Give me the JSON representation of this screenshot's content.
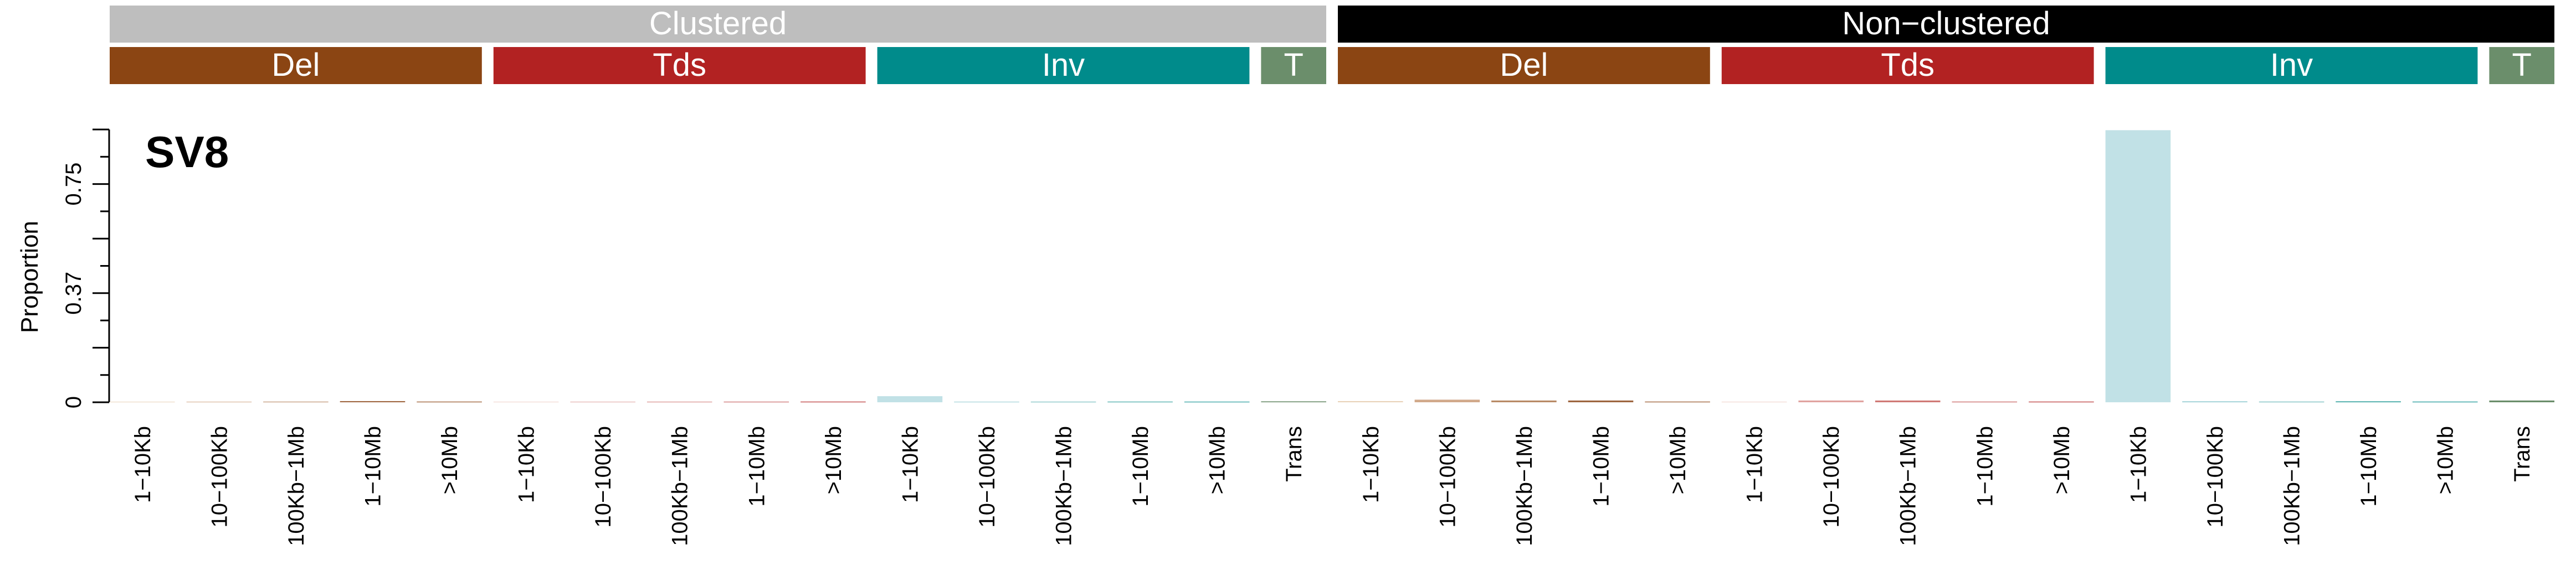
{
  "chart_data": {
    "type": "bar",
    "title": "SV8",
    "ylabel": "Proportion",
    "xlabel": "",
    "ylim": [
      0,
      0.9375
    ],
    "y_ticks_labeled": [
      {
        "value": 0,
        "label": "0"
      },
      {
        "value": 0.375,
        "label": "0.37"
      },
      {
        "value": 0.75,
        "label": "0.75"
      }
    ],
    "y_ticks_major": [
      0,
      0.1875,
      0.375,
      0.5625,
      0.75,
      0.9375
    ],
    "y_ticks_minor": [
      0.09375,
      0.28125,
      0.46875,
      0.65625,
      0.84375
    ],
    "grid": false,
    "legend": "none",
    "groups": [
      {
        "name": "Clustered",
        "color": "#BEBEBE",
        "subgroups": [
          {
            "name": "Del",
            "color": "#8B4513",
            "categories": [
              "1−10Kb",
              "10−100Kb",
              "100Kb−1Mb",
              "1−10Mb",
              ">10Mb"
            ],
            "values": [
              0.001,
              0.001,
              0.002,
              0.004,
              0.002
            ],
            "bar_colors": [
              "#E8D2B8",
              "#D1A98A",
              "#B98A66",
              "#9E6640",
              "#8B4513"
            ]
          },
          {
            "name": "Tds",
            "color": "#B22222",
            "categories": [
              "1−10Kb",
              "10−100Kb",
              "100Kb−1Mb",
              "1−10Mb",
              ">10Mb"
            ],
            "values": [
              0.001,
              0.001,
              0.001,
              0.001,
              0.002
            ],
            "bar_colors": [
              "#F0D0C8",
              "#E0A3A0",
              "#D07A76",
              "#C0504E",
              "#B22222"
            ]
          },
          {
            "name": "Inv",
            "color": "#008B8B",
            "categories": [
              "1−10Kb",
              "10−100Kb",
              "100Kb−1Mb",
              "1−10Mb",
              ">10Mb"
            ],
            "values": [
              0.021,
              0.001,
              0.001,
              0.002,
              0.001
            ],
            "bar_colors": [
              "#C1E1E6",
              "#91CAD0",
              "#61B3B5",
              "#30A09C",
              "#008B8B"
            ]
          },
          {
            "name": "T",
            "color": "#6B8E6B",
            "categories": [
              "Trans"
            ],
            "values": [
              0.003
            ],
            "bar_colors": [
              "#6B8E6B"
            ]
          }
        ]
      },
      {
        "name": "Non−clustered",
        "color": "#000000",
        "subgroups": [
          {
            "name": "Del",
            "color": "#8B4513",
            "categories": [
              "1−10Kb",
              "10−100Kb",
              "100Kb−1Mb",
              "1−10Mb",
              ">10Mb"
            ],
            "values": [
              0.004,
              0.009,
              0.006,
              0.006,
              0.002
            ],
            "bar_colors": [
              "#E8D2B8",
              "#D1A98A",
              "#B98A66",
              "#9E6640",
              "#8B4513"
            ]
          },
          {
            "name": "Tds",
            "color": "#B22222",
            "categories": [
              "1−10Kb",
              "10−100Kb",
              "100Kb−1Mb",
              "1−10Mb",
              ">10Mb"
            ],
            "values": [
              0.001,
              0.006,
              0.006,
              0.002,
              0.002
            ],
            "bar_colors": [
              "#F0D0C8",
              "#E0A3A0",
              "#D07A76",
              "#C0504E",
              "#B22222"
            ]
          },
          {
            "name": "Inv",
            "color": "#008B8B",
            "categories": [
              "1−10Kb",
              "10−100Kb",
              "100Kb−1Mb",
              "1−10Mb",
              ">10Mb"
            ],
            "values": [
              0.935,
              0.003,
              0.002,
              0.003,
              0.002
            ],
            "bar_colors": [
              "#C1E1E6",
              "#91CAD0",
              "#61B3B5",
              "#30A09C",
              "#008B8B"
            ]
          },
          {
            "name": "T",
            "color": "#6B8E6B",
            "categories": [
              "Trans"
            ],
            "values": [
              0.006
            ],
            "bar_colors": [
              "#6B8E6B"
            ]
          }
        ]
      }
    ]
  }
}
